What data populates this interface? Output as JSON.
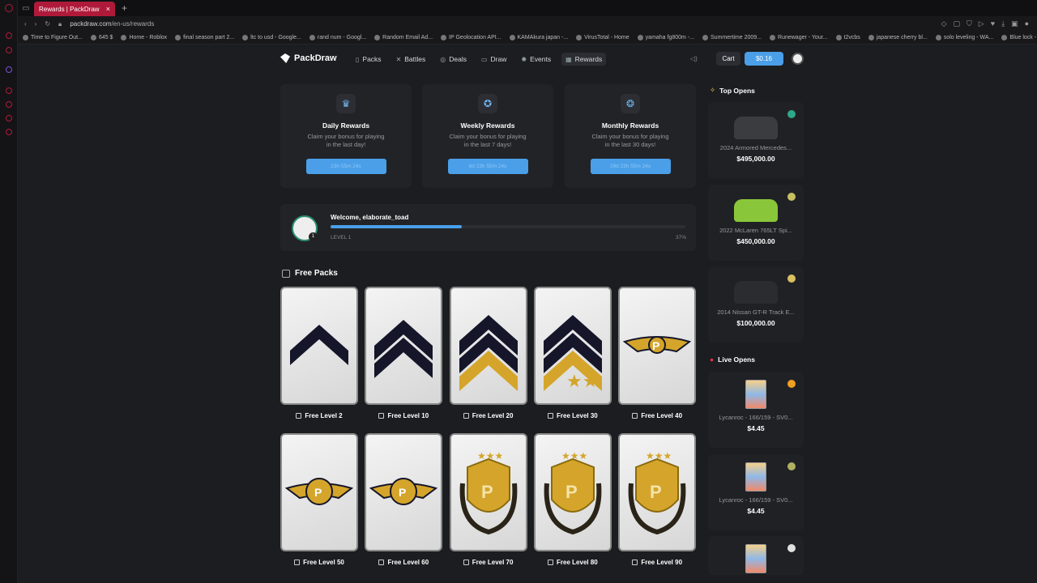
{
  "browser": {
    "tab_title": "Rewards | PackDraw",
    "url_host": "packdraw.com",
    "url_path": "/en-us/rewards",
    "bookmarks": [
      "Time to Figure Out...",
      "645 $",
      "Home - Roblox",
      "final season part 2...",
      "ltc to usd - Google...",
      "rand num - Googl...",
      "Random Email Ad...",
      "IP Geolocation API...",
      "KAMAkura japan -...",
      "VirusTotal - Home",
      "yamaha fg800m -...",
      "Summertime 2009...",
      "Runewager - Your...",
      "t2vcbs",
      "japanese cherry bl...",
      "solo leveling - WA...",
      "Blue lock - WATC..."
    ]
  },
  "nav": {
    "logo": "PackDraw",
    "links": [
      "Packs",
      "Battles",
      "Deals",
      "Draw",
      "Events",
      "Rewards"
    ],
    "active": "Rewards",
    "cart": "Cart",
    "balance": "$0.16"
  },
  "rewards": [
    {
      "title": "Daily Rewards",
      "desc": "Claim your bonus for playing in the last day!",
      "button": "23h 55m 24s",
      "icon": "crown-icon"
    },
    {
      "title": "Weekly Rewards",
      "desc": "Claim your bonus for playing in the last 7 days!",
      "button": "6d 23h 55m 24s",
      "icon": "medal-icon"
    },
    {
      "title": "Monthly Rewards",
      "desc": "Claim your bonus for playing in the last 30 days!",
      "button": "29d 23h 55m 24s",
      "icon": "award-icon"
    }
  ],
  "welcome": {
    "text": "Welcome, elaborate_toad",
    "level": "LEVEL 1",
    "avatar_level": "1",
    "progress_percent": 37,
    "progress_label": "37%"
  },
  "free_packs": {
    "title": "Free Packs",
    "packs": [
      "Free Level 2",
      "Free Level 10",
      "Free Level 20",
      "Free Level 30",
      "Free Level 40",
      "Free Level 50",
      "Free Level 60",
      "Free Level 70",
      "Free Level 80",
      "Free Level 90"
    ]
  },
  "sidebar": {
    "top_opens_title": "Top Opens",
    "top_opens": [
      {
        "name": "2024 Armored Mercedes...",
        "price": "$495,000.00",
        "tag_color": "#2ea88a"
      },
      {
        "name": "2022 McLaren 765LT Spi...",
        "price": "$450,000.00",
        "tag_color": "#c8c060"
      },
      {
        "name": "2014 Nissan GT-R Track E...",
        "price": "$100,000.00",
        "tag_color": "#d8c060"
      }
    ],
    "live_opens_title": "Live Opens",
    "live_opens": [
      {
        "name": "Lycanroc - 166/159 - SV0...",
        "price": "$4.45",
        "tag_color": "#f0a020"
      },
      {
        "name": "Lycanroc - 166/159 - SV0...",
        "price": "$4.45",
        "tag_color": "#b0b060"
      },
      {
        "name": "",
        "price": "",
        "tag_color": "#e0e0e0"
      }
    ]
  }
}
